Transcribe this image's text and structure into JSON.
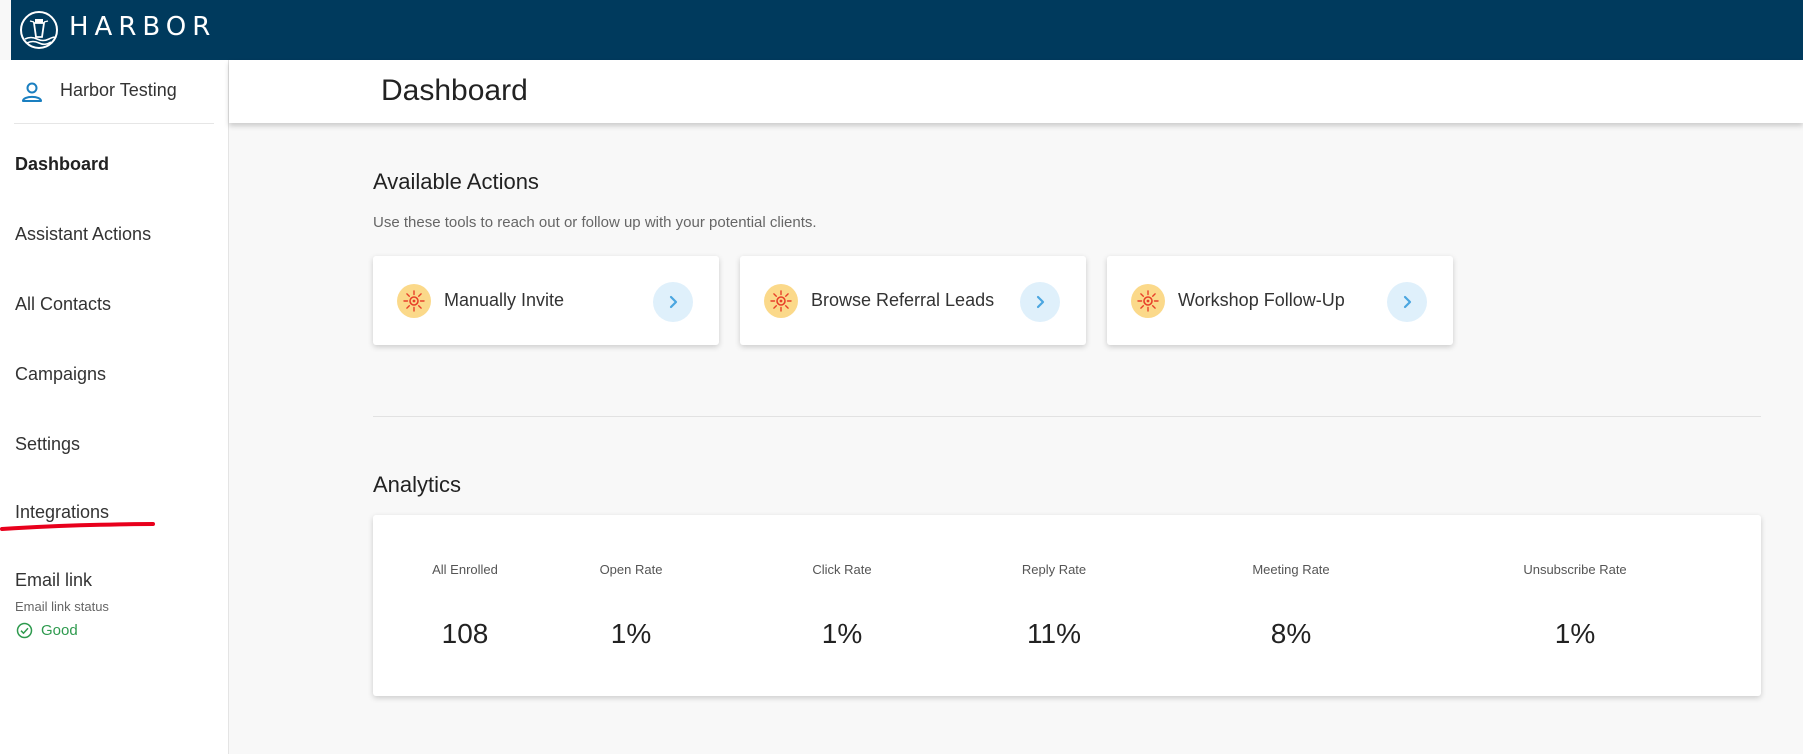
{
  "brand": {
    "name": "HARBOR",
    "header_color": "#003a5d"
  },
  "sidebar": {
    "user_name": "Harbor Testing",
    "items": [
      {
        "label": "Dashboard",
        "active": true
      },
      {
        "label": "Assistant Actions"
      },
      {
        "label": "All Contacts"
      },
      {
        "label": "Campaigns"
      },
      {
        "label": "Settings"
      },
      {
        "label": "Integrations"
      }
    ],
    "email_link": {
      "title": "Email link",
      "subtitle": "Email link status",
      "status": "Good",
      "status_color": "#2e9a4e"
    }
  },
  "header": {
    "title": "Dashboard"
  },
  "actions": {
    "title": "Available Actions",
    "subtitle": "Use these tools to reach out or follow up with your potential clients.",
    "cards": [
      {
        "label": "Manually Invite",
        "icon": "sun-icon"
      },
      {
        "label": "Browse Referral Leads",
        "icon": "sun-icon"
      },
      {
        "label": "Workshop Follow-Up",
        "icon": "sun-icon"
      }
    ]
  },
  "analytics": {
    "title": "Analytics",
    "metrics": [
      {
        "label": "All Enrolled",
        "value": "108"
      },
      {
        "label": "Open Rate",
        "value": "1%"
      },
      {
        "label": "Click Rate",
        "value": "1%"
      },
      {
        "label": "Reply Rate",
        "value": "11%"
      },
      {
        "label": "Meeting Rate",
        "value": "8%"
      },
      {
        "label": "Unsubscribe Rate",
        "value": "1%"
      }
    ]
  },
  "annotation": {
    "mark": "red-underline",
    "color": "#e8001c"
  }
}
